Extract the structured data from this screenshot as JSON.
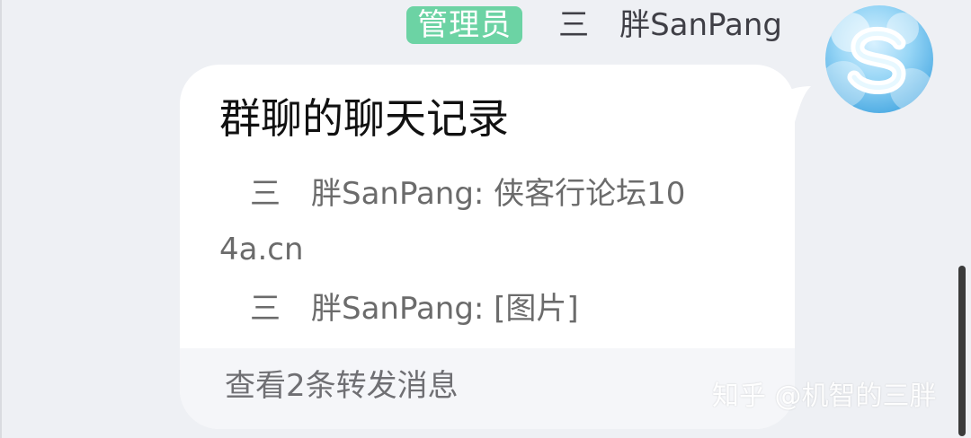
{
  "sender": {
    "role_badge": "管理员",
    "name": "三　胖SanPang"
  },
  "avatar": {
    "icon": "s-letter-cloud-avatar"
  },
  "message": {
    "title": "群聊的聊天记录",
    "preview_1_line_1": "　三　胖SanPang: 侠客行论坛10",
    "preview_1_line_2": "4a.cn",
    "preview_2": "　三　胖SanPang: [图片]",
    "footer": "查看2条转发消息"
  },
  "watermark": {
    "text": "知乎 @机智的三胖"
  },
  "colors": {
    "background": "#eef0f4",
    "badge": "#6cd3a4",
    "bubble": "#ffffff",
    "footer": "#f5f6f9"
  }
}
